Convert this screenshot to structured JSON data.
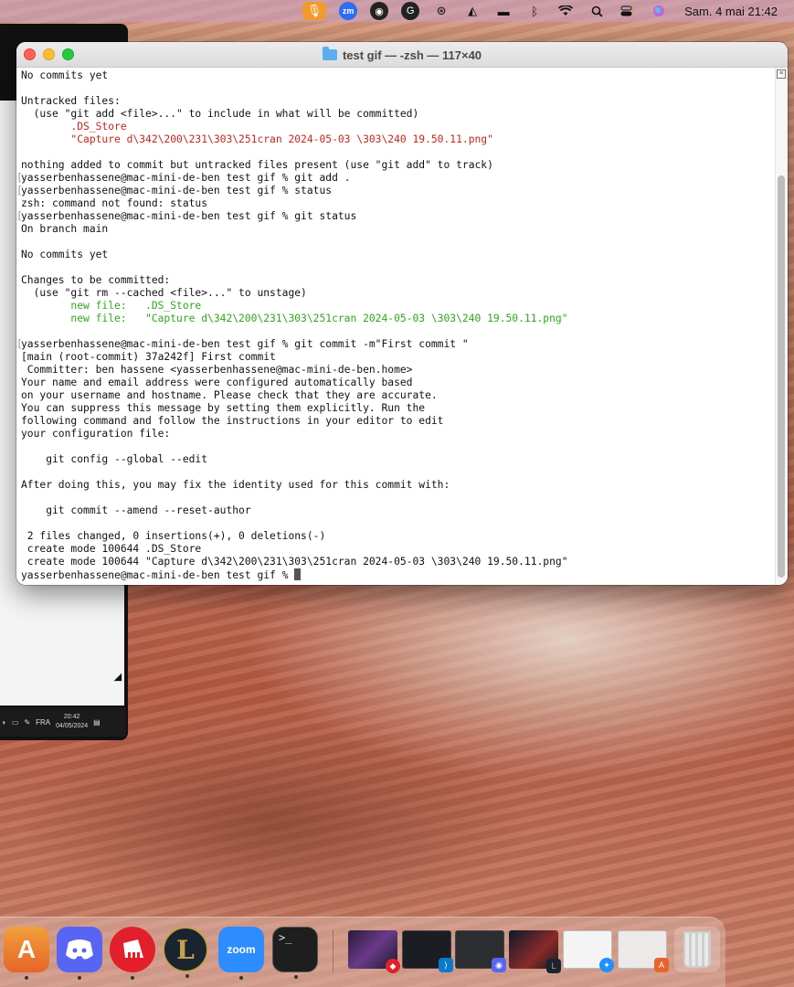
{
  "menubar": {
    "icons": [
      "microphone-icon",
      "zoom-icon",
      "app-icon",
      "grammarly-icon",
      "steam-icon",
      "affinity-icon",
      "bed-icon",
      "bluetooth-icon",
      "wifi-icon",
      "search-icon",
      "control-center-icon",
      "siri-icon"
    ],
    "zoom_label": "zm",
    "clock": "Sam. 4 mai  21:42"
  },
  "background_window": {
    "taskbar_lang": "FRA",
    "taskbar_time": "20:42",
    "taskbar_date": "04/05/2024"
  },
  "terminal": {
    "title": "test gif — -zsh — 117×40",
    "lines": [
      {
        "text": "No commits yet",
        "color": "default"
      },
      {
        "text": "",
        "color": "default"
      },
      {
        "text": "Untracked files:",
        "color": "default"
      },
      {
        "text": "  (use \"git add <file>...\" to include in what will be committed)",
        "color": "default"
      },
      {
        "text": "        .DS_Store",
        "color": "red"
      },
      {
        "text": "        \"Capture d\\342\\200\\231\\303\\251cran 2024-05-03 \\303\\240 19.50.11.png\"",
        "color": "red"
      },
      {
        "text": "",
        "color": "default"
      },
      {
        "text": "nothing added to commit but untracked files present (use \"git add\" to track)",
        "color": "default"
      },
      {
        "text": "yasserbenhassene@mac-mini-de-ben test gif % git add .",
        "color": "default",
        "marked": true
      },
      {
        "text": "yasserbenhassene@mac-mini-de-ben test gif % status",
        "color": "default",
        "marked": true
      },
      {
        "text": "zsh: command not found: status",
        "color": "default"
      },
      {
        "text": "yasserbenhassene@mac-mini-de-ben test gif % git status",
        "color": "default",
        "marked": true
      },
      {
        "text": "On branch main",
        "color": "default"
      },
      {
        "text": "",
        "color": "default"
      },
      {
        "text": "No commits yet",
        "color": "default"
      },
      {
        "text": "",
        "color": "default"
      },
      {
        "text": "Changes to be committed:",
        "color": "default"
      },
      {
        "text": "  (use \"git rm --cached <file>...\" to unstage)",
        "color": "default"
      },
      {
        "text": "        new file:   .DS_Store",
        "color": "green"
      },
      {
        "text": "        new file:   \"Capture d\\342\\200\\231\\303\\251cran 2024-05-03 \\303\\240 19.50.11.png\"",
        "color": "green"
      },
      {
        "text": "",
        "color": "default"
      },
      {
        "text": "yasserbenhassene@mac-mini-de-ben test gif % git commit -m\"First commit \"",
        "color": "default",
        "marked": true
      },
      {
        "text": "[main (root-commit) 37a242f] First commit",
        "color": "default"
      },
      {
        "text": " Committer: ben hassene <yasserbenhassene@mac-mini-de-ben.home>",
        "color": "default"
      },
      {
        "text": "Your name and email address were configured automatically based",
        "color": "default"
      },
      {
        "text": "on your username and hostname. Please check that they are accurate.",
        "color": "default"
      },
      {
        "text": "You can suppress this message by setting them explicitly. Run the",
        "color": "default"
      },
      {
        "text": "following command and follow the instructions in your editor to edit",
        "color": "default"
      },
      {
        "text": "your configuration file:",
        "color": "default"
      },
      {
        "text": "",
        "color": "default"
      },
      {
        "text": "    git config --global --edit",
        "color": "default"
      },
      {
        "text": "",
        "color": "default"
      },
      {
        "text": "After doing this, you may fix the identity used for this commit with:",
        "color": "default"
      },
      {
        "text": "",
        "color": "default"
      },
      {
        "text": "    git commit --amend --reset-author",
        "color": "default"
      },
      {
        "text": "",
        "color": "default"
      },
      {
        "text": " 2 files changed, 0 insertions(+), 0 deletions(-)",
        "color": "default"
      },
      {
        "text": " create mode 100644 .DS_Store",
        "color": "default"
      },
      {
        "text": " create mode 100644 \"Capture d\\342\\200\\231\\303\\251cran 2024-05-03 \\303\\240 19.50.11.png\"",
        "color": "default"
      },
      {
        "text": "yasserbenhassene@mac-mini-de-ben test gif % ",
        "color": "default",
        "cursor": true
      }
    ]
  },
  "dock": {
    "apps": [
      "App Store",
      "Discord",
      "Riot Client",
      "League of Legends",
      "Zoom",
      "Terminal"
    ],
    "zoom_label": "zoom",
    "terminal_label": ">_",
    "appstore_label": "A",
    "league_label": "L"
  },
  "colors": {
    "red_text": "#c0271c",
    "green_text": "#2fa51c"
  }
}
